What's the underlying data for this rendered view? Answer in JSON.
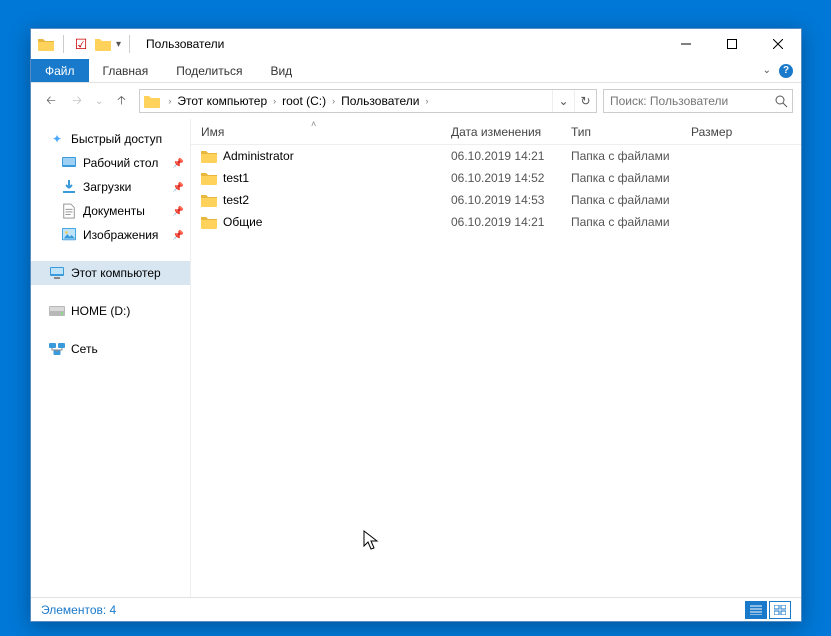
{
  "window": {
    "title": "Пользователи"
  },
  "ribbon": {
    "file": "Файл",
    "tabs": [
      "Главная",
      "Поделиться",
      "Вид"
    ]
  },
  "address": {
    "crumbs": [
      "Этот компьютер",
      "root (C:)",
      "Пользователи"
    ]
  },
  "search": {
    "placeholder": "Поиск: Пользователи"
  },
  "sidebar": {
    "quick": {
      "label": "Быстрый доступ"
    },
    "pinned": [
      {
        "label": "Рабочий стол",
        "icon": "desktop"
      },
      {
        "label": "Загрузки",
        "icon": "download"
      },
      {
        "label": "Документы",
        "icon": "document"
      },
      {
        "label": "Изображения",
        "icon": "image"
      }
    ],
    "thispc": {
      "label": "Этот компьютер"
    },
    "drives": [
      {
        "label": "HOME (D:)"
      }
    ],
    "network": {
      "label": "Сеть"
    }
  },
  "columns": {
    "name": "Имя",
    "date": "Дата изменения",
    "type": "Тип",
    "size": "Размер"
  },
  "files": [
    {
      "name": "Administrator",
      "date": "06.10.2019 14:21",
      "type": "Папка с файлами"
    },
    {
      "name": "test1",
      "date": "06.10.2019 14:52",
      "type": "Папка с файлами"
    },
    {
      "name": "test2",
      "date": "06.10.2019 14:53",
      "type": "Папка с файлами"
    },
    {
      "name": "Общие",
      "date": "06.10.2019 14:21",
      "type": "Папка с файлами"
    }
  ],
  "status": {
    "text": "Элементов: 4"
  }
}
